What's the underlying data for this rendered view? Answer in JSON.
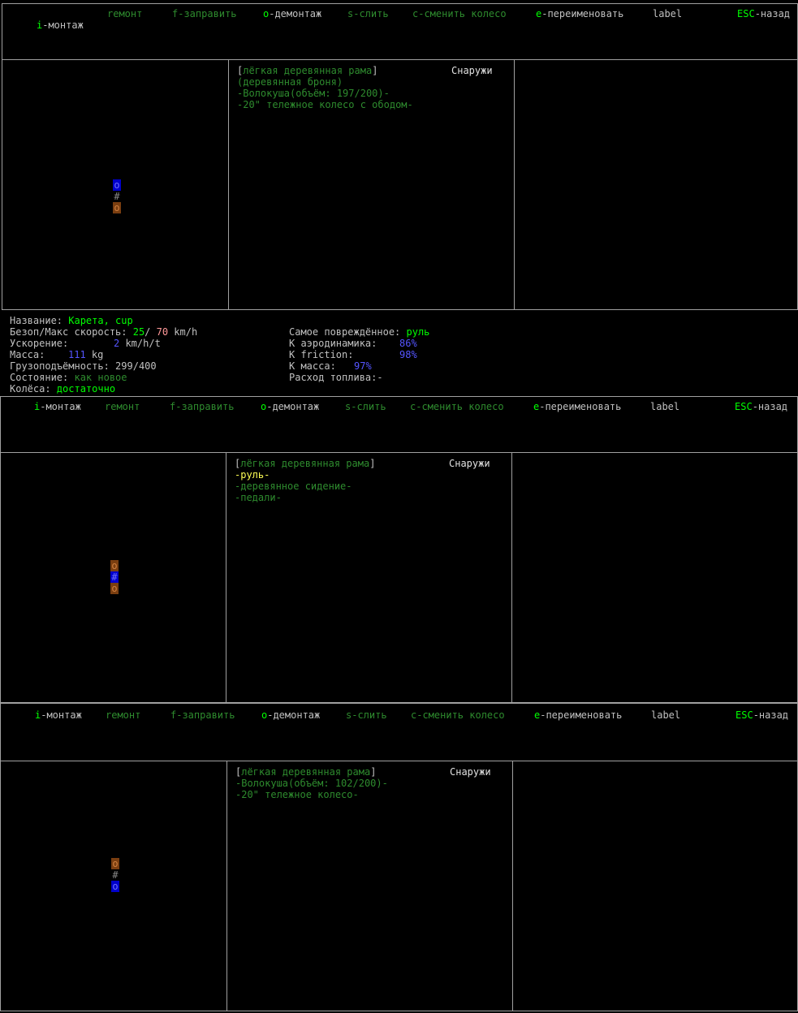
{
  "menu": {
    "install_key": "i",
    "install_label": "-монтаж",
    "repair_key": "r",
    "repair_label": "емонт",
    "refill_key": "f",
    "refill_label": "-заправить",
    "remove_key": "o",
    "remove_label": "-демонтаж",
    "siphon_key": "s",
    "siphon_label": "-слить",
    "change_wheel_key": "c",
    "change_wheel_label": "-сменить колесо",
    "rename_key": "e",
    "rename_label": "-переименовать",
    "label_label": "label",
    "back_key": "ESC",
    "back_label": "-назад"
  },
  "panel1": {
    "frame": "лёгкая деревянная рама",
    "location": "Снаружи",
    "parts": [
      "(деревянная броня)",
      "-Волокуша(объём: 197/200)-",
      "-20\" тележное колесо с ободом-"
    ]
  },
  "panel2": {
    "frame": "лёгкая деревянная рама",
    "location": "Снаружи",
    "parts": [
      "-руль-",
      "-деревянное сидение-",
      "-педали-"
    ]
  },
  "panel3": {
    "frame": "лёгкая деревянная рама",
    "location": "Снаружи",
    "parts": [
      "-Волокуша(объём: 102/200)-",
      "-20\" тележное колесо-"
    ]
  },
  "stats": {
    "name_label": "Название: ",
    "name_value": "Карета, cup",
    "speed_label": "Безоп/Макс скорость: ",
    "speed_safe": "25",
    "speed_sep": "/ ",
    "speed_max": "70",
    "speed_unit": " km/h",
    "accel_label": "Ускорение: ",
    "accel_value": "2",
    "accel_unit": " km/h/t",
    "mass_label": "Масса: ",
    "mass_value": "111",
    "mass_unit": " kg",
    "cargo_label": "Грузоподъёмность: ",
    "cargo_value": "299/400",
    "condition_label": "Состояние: ",
    "condition_value": "как новое",
    "wheels_label": "Колёса: ",
    "wheels_value": "достаточно",
    "damaged_label": "Самое повреждённое: ",
    "damaged_value": "руль",
    "aero_label": "К аэродинамика: ",
    "aero_value": "86%",
    "friction_label": "K friction: ",
    "friction_value": "98%",
    "kmass_label": "К масса: ",
    "kmass_value": "97%",
    "fuel_label": "Расход топлива:",
    "fuel_value": "-"
  },
  "vehicle_glyphs": {
    "wheel": "o",
    "frame": "#"
  },
  "colors": {
    "bright_green": "#00ff00",
    "dark_green": "#2e8b2e",
    "blue": "#5555ff",
    "brown": "#7a3e10"
  }
}
